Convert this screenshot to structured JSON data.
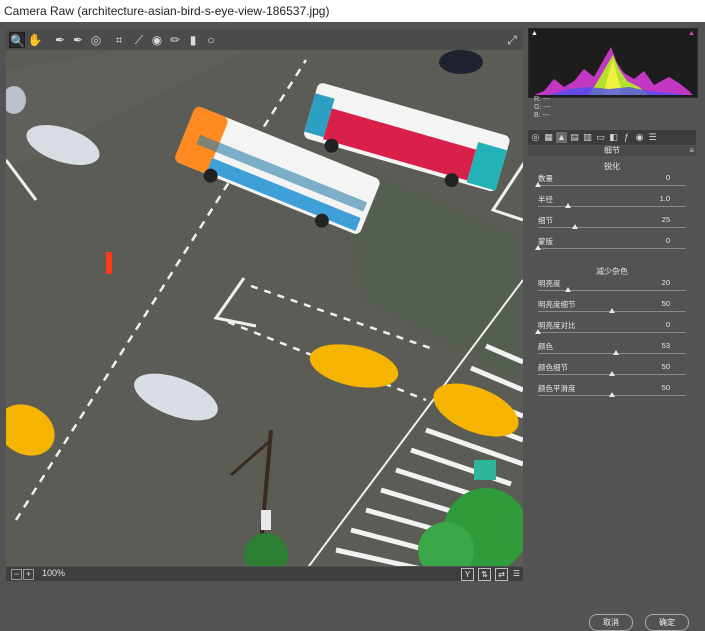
{
  "window": {
    "title": "Camera Raw (architecture-asian-bird-s-eye-view-186537.jpg)"
  },
  "toolbar": {
    "tools": [
      "zoom-tool",
      "hand-tool",
      "white-balance-tool",
      "color-sampler-tool",
      "targeted-adjustment-tool",
      "crop-tool",
      "straighten-tool",
      "spot-removal-tool",
      "red-eye-tool",
      "adjustment-brush",
      "graduated-filter",
      "radial-filter"
    ],
    "glyphs": {
      "zoom": "🔍",
      "hand": "✋",
      "wb": "✒",
      "sampler": "✒",
      "target": "◎",
      "crop": "⌗",
      "straighten": "⟋",
      "spot": "✎",
      "redeye": "◉",
      "brush": "✏",
      "grad": "▮",
      "radial": "○",
      "fullscreen": "⤢"
    }
  },
  "statusbar": {
    "zoom": "100%",
    "view_y": "Y",
    "zoom_minus": "−",
    "zoom_plus": "+"
  },
  "histogram": {
    "r_label": "R:",
    "g_label": "G:",
    "b_label": "B:",
    "r": "---",
    "g": "---",
    "b": "---"
  },
  "panel": {
    "title": "细节",
    "sharpening": {
      "header": "锐化",
      "sliders": [
        {
          "label": "数量",
          "value": "0",
          "pos": 0.0
        },
        {
          "label": "半径",
          "value": "1.0",
          "pos": 0.2
        },
        {
          "label": "细节",
          "value": "25",
          "pos": 0.25
        },
        {
          "label": "蒙版",
          "value": "0",
          "pos": 0.0
        }
      ]
    },
    "noise": {
      "header": "减少杂色",
      "sliders": [
        {
          "label": "明亮度",
          "value": "20",
          "pos": 0.2
        },
        {
          "label": "明亮度细节",
          "value": "50",
          "pos": 0.5
        },
        {
          "label": "明亮度对比",
          "value": "0",
          "pos": 0.0
        },
        {
          "label": "颜色",
          "value": "53",
          "pos": 0.53
        },
        {
          "label": "颜色细节",
          "value": "50",
          "pos": 0.5
        },
        {
          "label": "颜色平滑度",
          "value": "50",
          "pos": 0.5
        }
      ]
    }
  },
  "buttons": {
    "cancel": "取消",
    "ok": "确定"
  },
  "colors": {
    "background": "#535353",
    "road": "#5b5b55",
    "bus_accent": "#ff8a1f",
    "bus_red": "#d8204a",
    "taxi": "#f5b400",
    "tree": "#2f9b3a"
  }
}
